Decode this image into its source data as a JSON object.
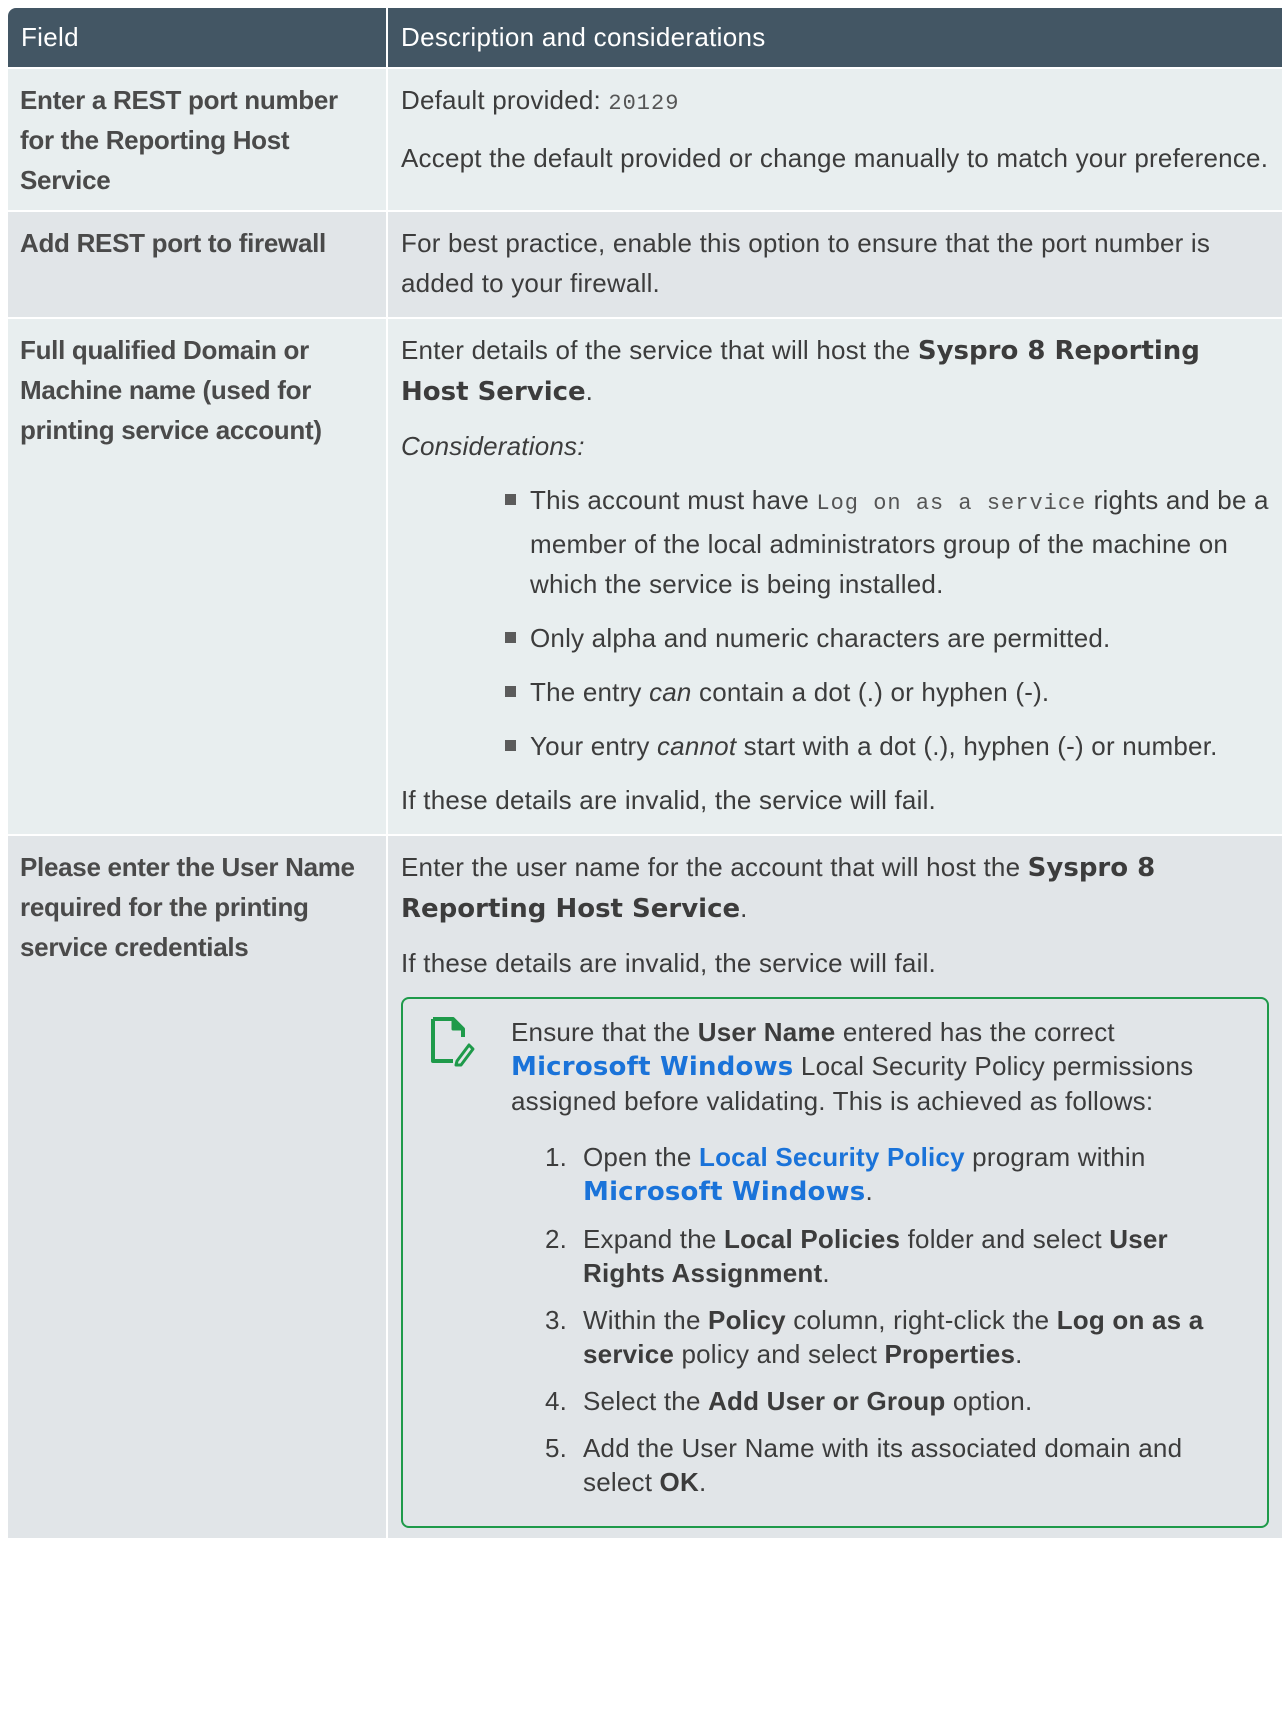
{
  "header": {
    "field": "Field",
    "description": "Description and considerations"
  },
  "rows": [
    {
      "field": "Enter a REST port number for the Reporting Host Service",
      "default_label": "Default provided:",
      "default_value": "20129",
      "text": "Accept the default provided or change manually to match your preference."
    },
    {
      "field": "Add REST port to firewall",
      "text": "For best practice, enable this option to ensure that the port number is added to your firewall."
    },
    {
      "field": "Full qualified Domain or Machine name (used for printing service account)",
      "intro_a": "Enter details of the service that will host the ",
      "intro_product": "Syspro 8 Reporting Host Service",
      "intro_end": ".",
      "considerations": "Considerations:",
      "bullet1_a": "This account must have ",
      "bullet1_code": "Log on as a service",
      "bullet1_b": " rights and be a member of the local administrators group of the machine on which the service is being installed.",
      "bullet2": "Only alpha and numeric characters are permitted.",
      "bullet3_a": "The entry ",
      "bullet3_em": "can",
      "bullet3_b": " contain a dot (.) or hyphen (-).",
      "bullet4_a": "Your entry ",
      "bullet4_em": "cannot",
      "bullet4_b": " start with a dot (.), hyphen (-) or number.",
      "outro": "If these details are invalid, the service will fail."
    },
    {
      "field": "Please enter the User Name required for the printing service credentials",
      "intro_a": "Enter the user name for the account that will host the ",
      "intro_product": "Syspro 8 Reporting Host Service",
      "intro_end": ".",
      "outro": "If these details are invalid, the service will fail.",
      "note": {
        "icon": "note-edit-icon",
        "text_a": "Ensure that the ",
        "text_b1": "User Name",
        "text_c": " entered has the correct ",
        "text_link": "Microsoft Windows",
        "text_d": " Local Security Policy permissions assigned before validating. This is achieved as follows:",
        "steps": [
          {
            "num": "1.",
            "a": "Open the ",
            "link": "Local Security Policy",
            "b": " program within ",
            "link2": "Microsoft Windows",
            "c": "."
          },
          {
            "num": "2.",
            "a": "Expand the ",
            "b1": "Local Policies",
            "b": " folder and select ",
            "b2": "User Rights Assignment",
            "c": "."
          },
          {
            "num": "3.",
            "a": "Within the ",
            "b1": "Policy",
            "b": " column, right-click the ",
            "b2": "Log on as a service",
            "c": " policy and select ",
            "b3": "Properties",
            "d": "."
          },
          {
            "num": "4.",
            "a": "Select the ",
            "b1": "Add User or Group",
            "b": " option."
          },
          {
            "num": "5.",
            "a": "Add the User Name with its associated domain and select ",
            "b1": "OK",
            "b": "."
          }
        ]
      }
    }
  ],
  "colors": {
    "header_bg": "#435664",
    "row_light": "#e8eeef",
    "row_dark": "#e1e5e8",
    "link": "#1a73d9",
    "note_border": "#1e9a4a"
  }
}
